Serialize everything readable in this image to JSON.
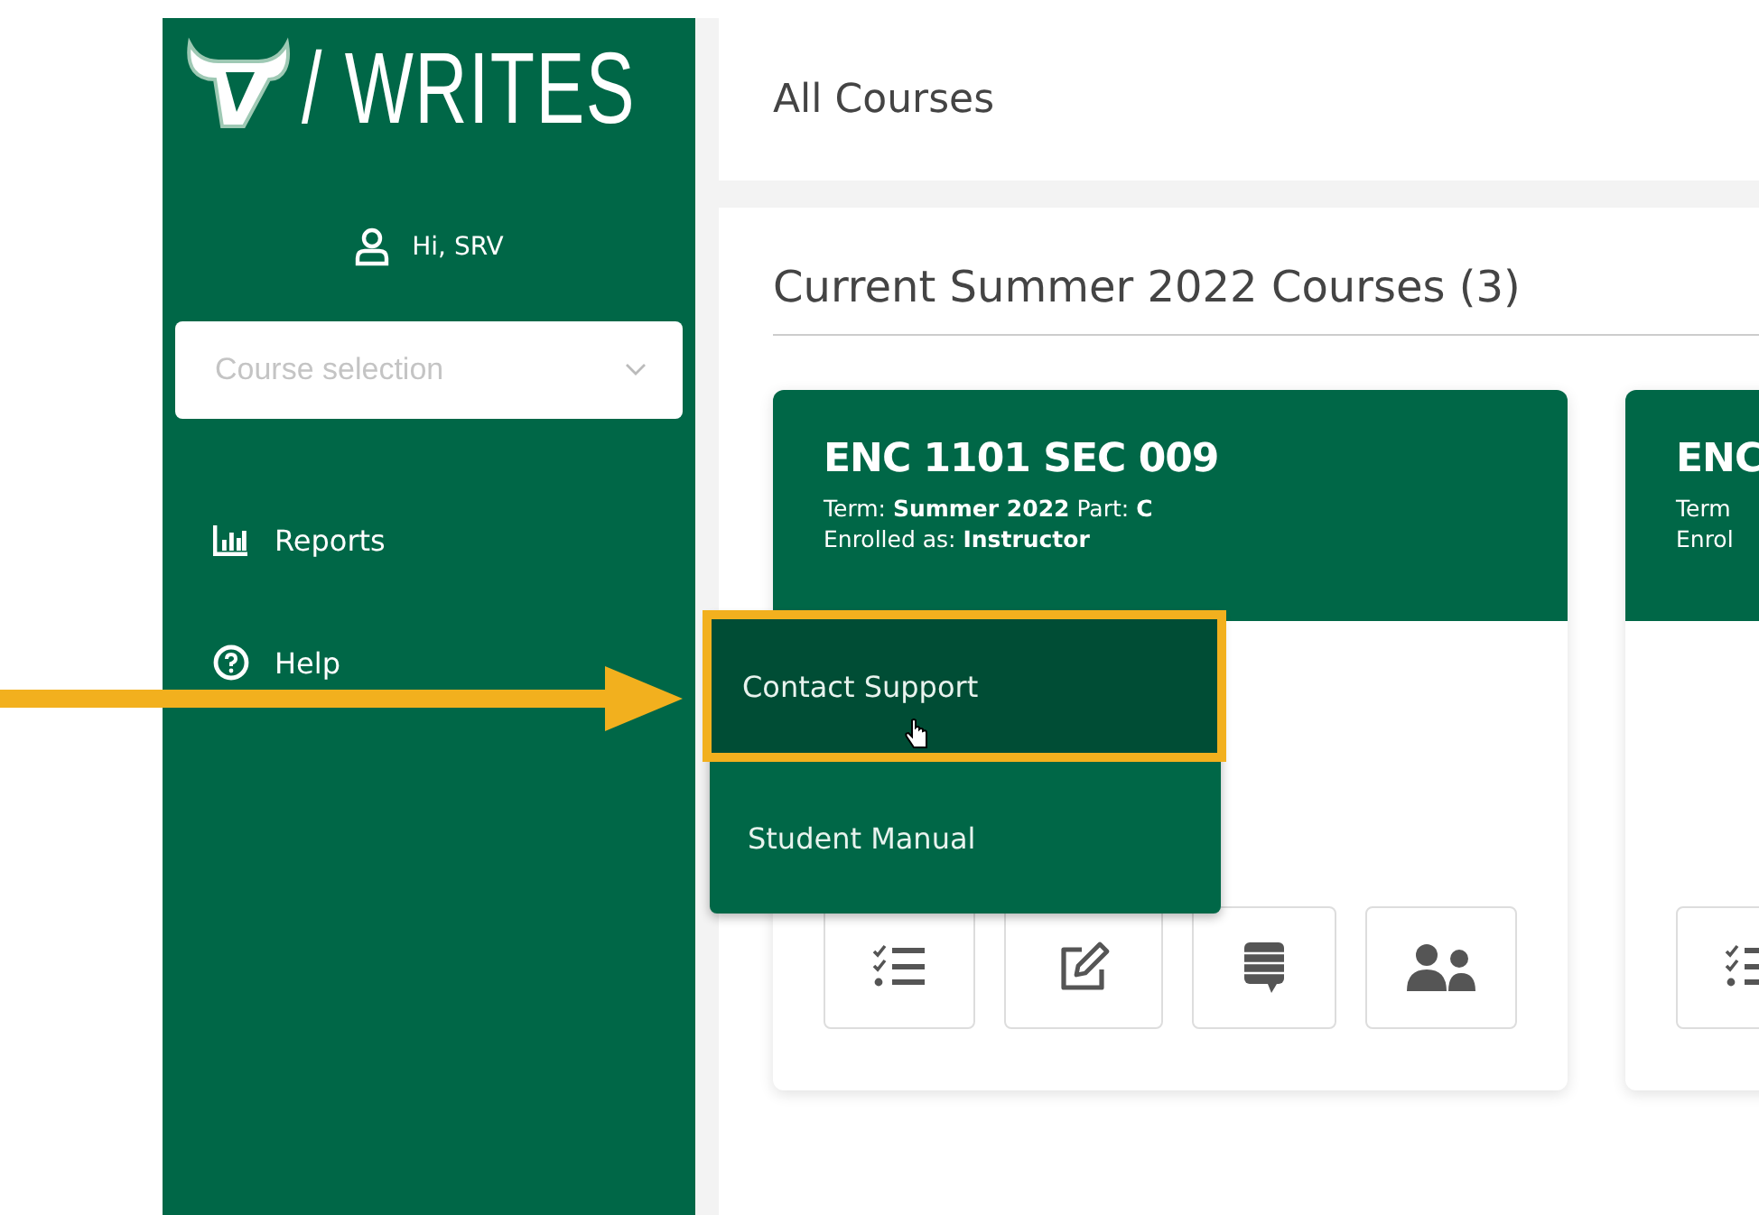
{
  "logo": {
    "text": "/ WRITES"
  },
  "user": {
    "greeting": "Hi, SRV"
  },
  "course_select": {
    "placeholder": "Course selection"
  },
  "nav": [
    {
      "label": "Reports",
      "kind": "chart"
    },
    {
      "label": "Help",
      "kind": "help"
    }
  ],
  "header": {
    "title": "All Courses"
  },
  "section": {
    "title": "Current Summer 2022 Courses (3)"
  },
  "courses": [
    {
      "title": "ENC 1101 SEC 009",
      "term_line": "Term: **Summer 2022** Part: **C**",
      "role_line": "Enrolled as: **Instructor**",
      "actions": [
        {
          "kind": "checklist"
        },
        {
          "kind": "edit"
        },
        {
          "kind": "comments"
        },
        {
          "kind": "people"
        }
      ]
    },
    {
      "title": "ENC",
      "term_line": "Term",
      "role_line": "Enrol",
      "actions": [
        {
          "kind": "checklist"
        }
      ]
    }
  ],
  "menu": [
    {
      "label": "Contact Support",
      "selected": true
    },
    {
      "label": "Student Manual",
      "selected": false
    }
  ]
}
